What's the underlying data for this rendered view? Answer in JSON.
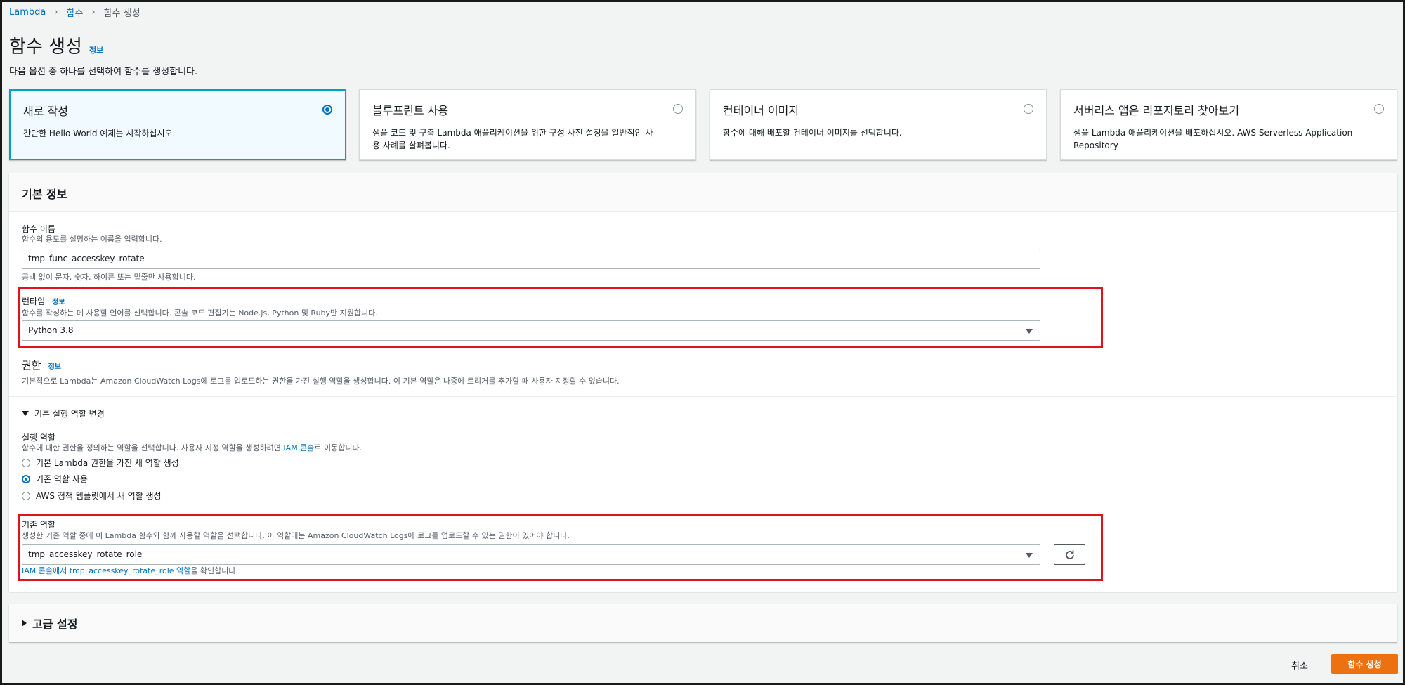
{
  "breadcrumb": {
    "items": [
      "Lambda",
      "함수",
      "함수 생성"
    ]
  },
  "page": {
    "title": "함수 생성",
    "info": "정보",
    "description": "다음 옵션 중 하나를 선택하여 함수를 생성합니다."
  },
  "options": [
    {
      "title": "새로 작성",
      "description": "간단한 Hello World 예제는 시작하십시오.",
      "selected": true
    },
    {
      "title": "블루프린트 사용",
      "description": "샘플 코드 및 구축 Lambda 애플리케이션을 위한 구성 사전 설정을 일반적인 사용 사례를 살펴봅니다.",
      "selected": false
    },
    {
      "title": "컨테이너 이미지",
      "description": "함수에 대해 배포할 컨테이너 이미지를 선택합니다.",
      "selected": false
    },
    {
      "title": "서버리스 앱은 리포지토리 찾아보기",
      "description": "샘플 Lambda 애플리케이션을 배포하십시오. AWS Serverless Application Repository",
      "selected": false
    }
  ],
  "basic": {
    "header": "기본 정보",
    "function_name": {
      "label": "함수 이름",
      "description": "함수의 용도를 설명하는 이름을 입력합니다.",
      "value": "tmp_func_accesskey_rotate",
      "hint": "공백 없이 문자, 숫자, 하이픈 또는 밑줄만 사용합니다."
    },
    "runtime": {
      "label": "런타임",
      "info": "정보",
      "description": "함수를 작성하는 데 사용할 언어를 선택합니다. 콘솔 코드 편집기는 Node.js, Python 및 Ruby만 지원합니다.",
      "value": "Python 3.8"
    },
    "permissions": {
      "title": "권한",
      "info": "정보",
      "description": "기본적으로 Lambda는 Amazon CloudWatch Logs에 로그를 업로드하는 권한을 가진 실행 역할을 생성합니다. 이 기본 역할은 나중에 트리거를 추가할 때 사용자 지정할 수 있습니다."
    },
    "role_toggle": "기본 실행 역할 변경",
    "exec_role": {
      "label": "실행 역할",
      "description_pre": "함수에 대한 권한을 정의하는 역할을 선택합니다. 사용자 지정 역할을 생성하려면 ",
      "description_link": "IAM 콘솔",
      "description_post": "로 이동합니다.",
      "choices": [
        {
          "label": "기본 Lambda 권한을 가진 새 역할 생성",
          "selected": false
        },
        {
          "label": "기존 역할 사용",
          "selected": true
        },
        {
          "label": "AWS 정책 템플릿에서 새 역할 생성",
          "selected": false
        }
      ]
    },
    "existing_role": {
      "label": "기존 역할",
      "description": "생성한 기존 역할 중에 이 Lambda 함수와 함께 사용할 역할을 선택합니다. 이 역할에는 Amazon CloudWatch Logs에 로그를 업로드할 수 있는 권한이 있어야 합니다.",
      "value": "tmp_accesskey_rotate_role",
      "hint_link": "IAM 콘솔에서 tmp_accesskey_rotate_role 역할",
      "hint_post": "을 확인합니다."
    }
  },
  "advanced": {
    "title": "고급 설정"
  },
  "footer": {
    "cancel": "취소",
    "create": "함수 생성"
  }
}
